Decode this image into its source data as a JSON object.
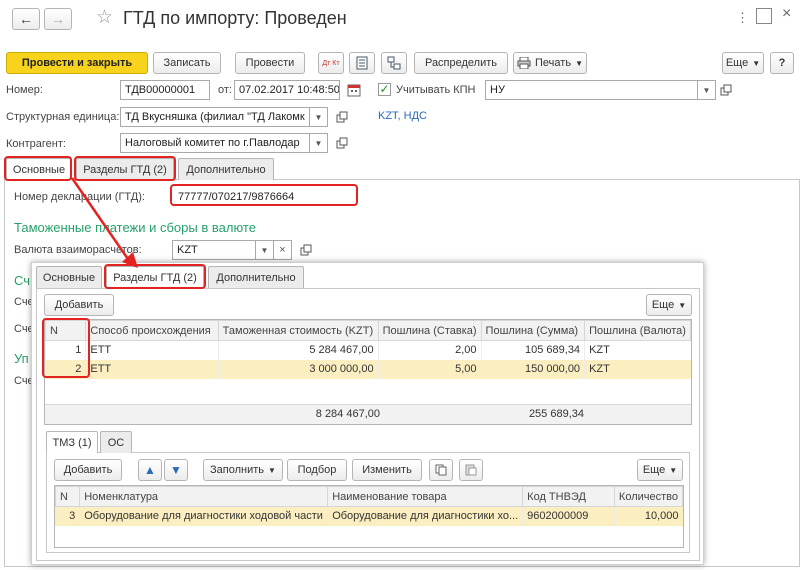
{
  "window": {
    "title": "ГТД по импорту: Проведен"
  },
  "toolbar": {
    "post_close": "Провести и закрыть",
    "save": "Записать",
    "post": "Провести",
    "dt_kt": "Дт Кт",
    "distribute": "Распределить",
    "print": "Печать",
    "more": "Еще"
  },
  "fields": {
    "number_label": "Номер:",
    "number_value": "ТДВ00000001",
    "date_label": "от:",
    "date_value": "07.02.2017 10:48:50",
    "kpn_label": "Учитывать КПН",
    "kpn_value": "НУ",
    "unit_label": "Структурная единица:",
    "unit_value": "ТД Вкусняшка (филиал \"ТД Лакомк",
    "currency_info": "KZT, НДС",
    "contractor_label": "Контрагент:",
    "contractor_value": "Налоговый комитет по г.Павлодар"
  },
  "tabs_main": [
    "Основные",
    "Разделы ГТД (2)",
    "Дополнительно"
  ],
  "main": {
    "decl_label": "Номер декларации (ГТД):",
    "decl_value": "77777/070217/9876664",
    "customs_heading": "Таможенные платежи и сборы в валюте",
    "settle_label": "Валюта взаиморасчетов:",
    "settle_value": "KZT",
    "heading_frag1": "Сч",
    "heading_frag2": "Уп",
    "lbl_frag1": "Сче",
    "lbl_frag2": "Сче",
    "lbl_frag3": "Сче"
  },
  "popup": {
    "tabs": [
      "Основные",
      "Разделы ГТД (2)",
      "Дополнительно"
    ],
    "add": "Добавить",
    "more": "Еще",
    "columns": [
      "N",
      "Способ происхождения",
      "Таможенная стоимость (KZT)",
      "Пошлина (Ставка)",
      "Пошлина (Сумма)",
      "Пошлина (Валюта)"
    ],
    "rows": [
      {
        "n": "1",
        "origin": "ЕТТ",
        "value": "5 284 467,00",
        "rate": "2,00",
        "sum": "105 689,34",
        "cur": "KZT"
      },
      {
        "n": "2",
        "origin": "ЕТТ",
        "value": "3 000 000,00",
        "rate": "5,00",
        "sum": "150 000,00",
        "cur": "KZT"
      }
    ],
    "totals": {
      "value": "8 284 467,00",
      "sum": "255 689,34"
    },
    "subtabs": [
      "ТМЗ (1)",
      "ОС"
    ],
    "sub_toolbar": {
      "add": "Добавить",
      "fill": "Заполнить",
      "select": "Подбор",
      "edit": "Изменить",
      "more": "Еще"
    },
    "sub_columns": [
      "N",
      "Номенклатура",
      "Наименование товара",
      "Код ТНВЭД",
      "Количество"
    ],
    "sub_rows": [
      {
        "n": "3",
        "item": "Оборудование для диагностики ходовой части",
        "name": "Оборудование для диагностики хо...",
        "code": "9602000009",
        "qty": "10,000"
      }
    ]
  },
  "colors": {
    "accent_yellow": "#f7d31d",
    "highlight": "#e32222",
    "group_green": "#26a169",
    "link_blue": "#2a6ab5"
  }
}
